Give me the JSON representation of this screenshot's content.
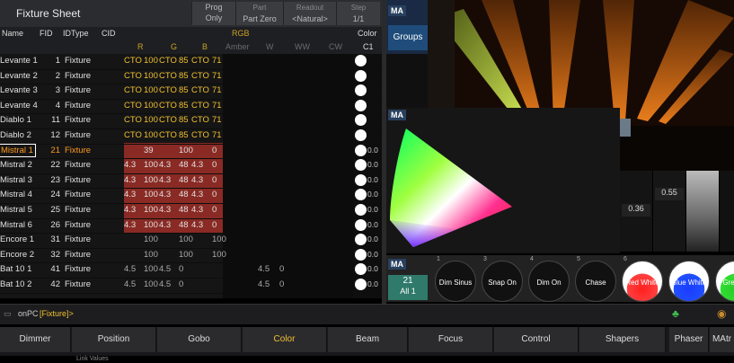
{
  "sheet": {
    "title": "Fixture Sheet",
    "buttons": [
      {
        "label": "Prog",
        "sub": "Only"
      },
      {
        "label": "Part",
        "sub": "Part Zero"
      },
      {
        "label": "Readout",
        "sub": "<Natural>"
      },
      {
        "label": "Step",
        "sub": "1/1"
      }
    ],
    "columns": [
      "Name",
      "FID",
      "IDType",
      "CID"
    ],
    "rgb_label": "RGB",
    "color_label": "Color",
    "sub_columns": [
      "R",
      "G",
      "B",
      "Amber",
      "W",
      "WW",
      "CW",
      "C1"
    ],
    "rows": [
      {
        "name": "Levante 1",
        "fid": "1",
        "type": "Fixture",
        "vals": [
          "CTO",
          "100",
          "CTO",
          "85",
          "CTO",
          "71"
        ],
        "y": true
      },
      {
        "name": "Levante 2",
        "fid": "2",
        "type": "Fixture",
        "vals": [
          "CTO",
          "100",
          "CTO",
          "85",
          "CTO",
          "71"
        ],
        "y": true
      },
      {
        "name": "Levante 3",
        "fid": "3",
        "type": "Fixture",
        "vals": [
          "CTO",
          "100",
          "CTO",
          "85",
          "CTO",
          "71"
        ],
        "y": true
      },
      {
        "name": "Levante 4",
        "fid": "4",
        "type": "Fixture",
        "vals": [
          "CTO",
          "100",
          "CTO",
          "85",
          "CTO",
          "71"
        ],
        "y": true
      },
      {
        "name": "Diablo 1",
        "fid": "11",
        "type": "Fixture",
        "vals": [
          "CTO",
          "100",
          "CTO",
          "85",
          "CTO",
          "71"
        ],
        "y": true
      },
      {
        "name": "Diablo 2",
        "fid": "12",
        "type": "Fixture",
        "vals": [
          "CTO",
          "100",
          "CTO",
          "85",
          "CTO",
          "71"
        ],
        "y": true
      },
      {
        "name": "Mistral 1",
        "fid": "21",
        "type": "Fixture",
        "vals": [
          "",
          "39",
          "",
          "100",
          "",
          "0"
        ],
        "sel": true
      },
      {
        "name": "Mistral 2",
        "fid": "22",
        "type": "Fixture",
        "vals": [
          "4.3",
          "100",
          "4.3",
          "48",
          "4.3",
          "0"
        ]
      },
      {
        "name": "Mistral 3",
        "fid": "23",
        "type": "Fixture",
        "vals": [
          "4.3",
          "100",
          "4.3",
          "48",
          "4.3",
          "0"
        ]
      },
      {
        "name": "Mistral 4",
        "fid": "24",
        "type": "Fixture",
        "vals": [
          "4.3",
          "100",
          "4.3",
          "48",
          "4.3",
          "0"
        ]
      },
      {
        "name": "Mistral 5",
        "fid": "25",
        "type": "Fixture",
        "vals": [
          "4.3",
          "100",
          "4.3",
          "48",
          "4.3",
          "0"
        ]
      },
      {
        "name": "Mistral 6",
        "fid": "26",
        "type": "Fixture",
        "vals": [
          "4.3",
          "100",
          "4.3",
          "48",
          "4.3",
          "0"
        ]
      },
      {
        "name": "Encore 1",
        "fid": "31",
        "type": "Fixture",
        "vals": [
          "",
          "100",
          "",
          "100",
          "",
          "100"
        ]
      },
      {
        "name": "Encore 2",
        "fid": "32",
        "type": "Fixture",
        "vals": [
          "",
          "100",
          "",
          "100",
          "",
          "100"
        ]
      },
      {
        "name": "Bat 10 1",
        "fid": "41",
        "type": "Fixture",
        "vals": [
          "4.5",
          "100",
          "4.5",
          "0",
          "",
          ""
        ],
        "w": "4.5",
        "w2": "0"
      },
      {
        "name": "Bat 10 2",
        "fid": "42",
        "type": "Fixture",
        "vals": [
          "4.5",
          "100",
          "4.5",
          "0",
          "",
          ""
        ],
        "w": "4.5",
        "w2": "0"
      }
    ],
    "c1_vals": [
      "",
      "",
      "",
      "",
      "",
      "",
      "0.0",
      "0.0",
      "0.0",
      "0.0",
      "0.0",
      "0.0",
      "0.0",
      "0.0",
      "0.0",
      "0.0"
    ]
  },
  "panel": {
    "ma_badge": "MA",
    "groups_label": "Groups",
    "fader_vals": [
      "0.36",
      "0.55"
    ],
    "sel_fixture": "21",
    "sel_all": "All 1"
  },
  "presets": [
    {
      "num": "1",
      "label": "Dim Sinus"
    },
    {
      "num": "3",
      "label": "Snap On"
    },
    {
      "num": "4",
      "label": "Dim On"
    },
    {
      "num": "5",
      "label": "Chase"
    },
    {
      "num": "6",
      "label": "Red White"
    },
    {
      "num": "",
      "label": "Blue White"
    },
    {
      "num": "",
      "label": "Gre Whi"
    }
  ],
  "cmdline": {
    "prompt": "onPC",
    "text": "[Fixture]>"
  },
  "tabs": [
    "Dimmer",
    "Position",
    "Gobo",
    "Color",
    "Beam",
    "Focus",
    "Control",
    "Shapers",
    "Phaser",
    "MAtr"
  ],
  "link_values": "Link Values"
}
